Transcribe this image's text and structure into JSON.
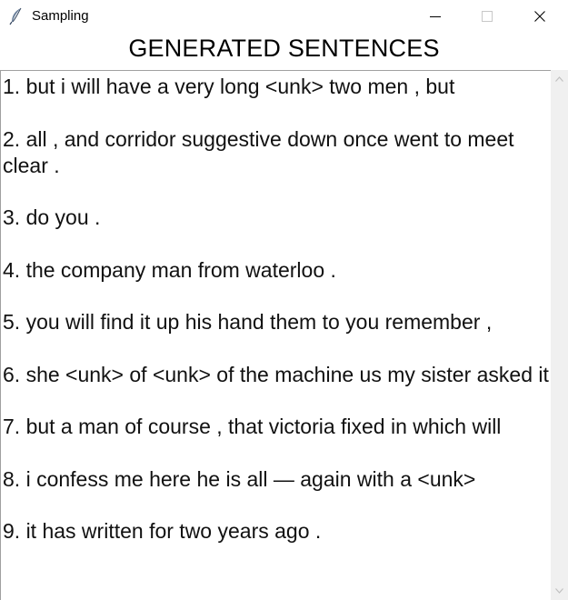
{
  "window": {
    "title": "Sampling",
    "icon": "feather-icon",
    "controls": [
      "minimize-icon",
      "maximize-icon",
      "close-icon"
    ]
  },
  "heading": "GENERATED SENTENCES",
  "sentences": [
    "1. but i will have a very long <unk> two men , but",
    "2. all , and corridor suggestive down once went to meet clear .",
    "3. do you .",
    "4. the company man from waterloo .",
    "5. you will find it up his hand them to you remember ,",
    "6. she <unk> of <unk> of the machine us my sister asked it",
    "7. but a man of course , that victoria fixed in which will",
    "8. i confess me here he is all — again with a <unk>",
    "9. it has written for two years ago ."
  ],
  "scrollbar": {
    "up_icon": "chevron-up-icon",
    "down_icon": "chevron-down-icon"
  },
  "colors": {
    "background": "#ffffff",
    "text": "#111111",
    "scrollbar_track": "#f0f0f0",
    "border": "#a0a0a0"
  }
}
